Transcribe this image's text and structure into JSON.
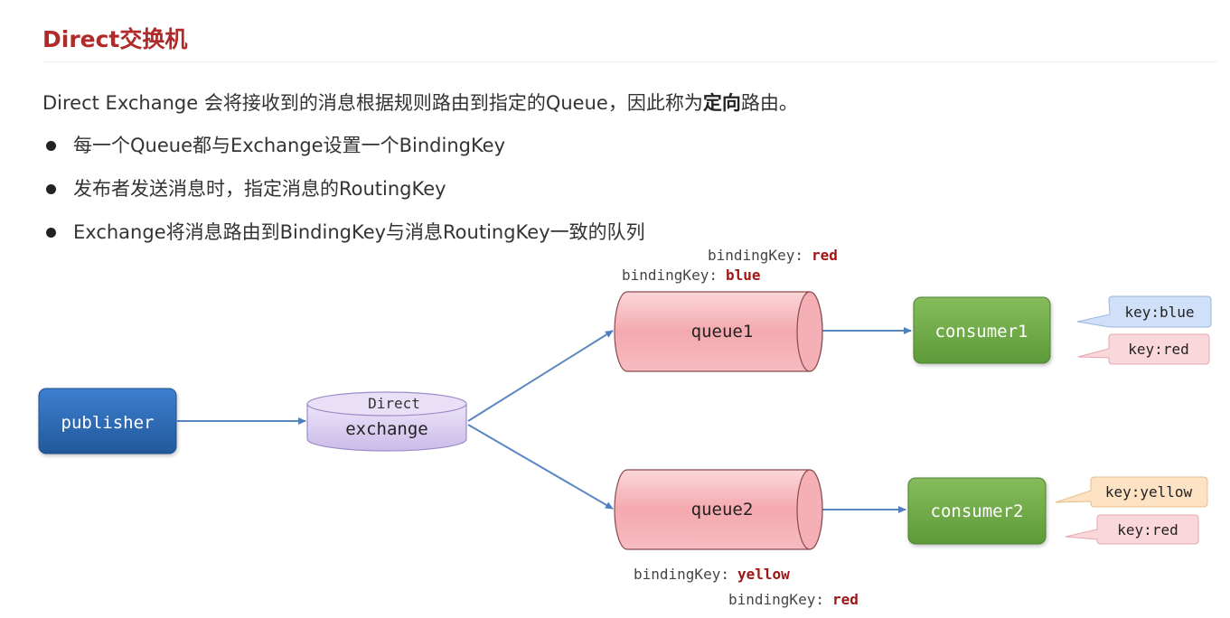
{
  "title": "Direct交换机",
  "intro": {
    "before": "Direct Exchange 会将接收到的消息根据规则路由到指定的Queue，因此称为",
    "emphasis": "定向",
    "after": "路由。"
  },
  "bullets": [
    "每一个Queue都与Exchange设置一个BindingKey",
    "发布者发送消息时，指定消息的RoutingKey",
    "Exchange将消息路由到BindingKey与消息RoutingKey一致的队列"
  ],
  "diagram": {
    "publisher": "publisher",
    "exchange": {
      "type_label": "Direct",
      "label": "exchange"
    },
    "queue1": {
      "label": "queue1",
      "binding_label": "bindingKey:",
      "binding_keys": [
        "red",
        "blue"
      ]
    },
    "queue2": {
      "label": "queue2",
      "binding_label": "bindingKey:",
      "binding_keys": [
        "yellow",
        "red"
      ]
    },
    "consumer1": {
      "label": "consumer1",
      "keys": [
        "key:blue",
        "key:red"
      ]
    },
    "consumer2": {
      "label": "consumer2",
      "keys": [
        "key:yellow",
        "key:red"
      ]
    }
  },
  "colors": {
    "title": "#b02a2a",
    "key_value": "#a01616",
    "publisher": "#2f6db8",
    "exchange": "#d9ccf0",
    "queue": "#f6b8bc",
    "consumer": "#6fa84a",
    "callout_blue": "#cfe0f8",
    "callout_pink": "#fad7da",
    "callout_orange": "#fde2c4",
    "arrow": "#5a86c2"
  }
}
